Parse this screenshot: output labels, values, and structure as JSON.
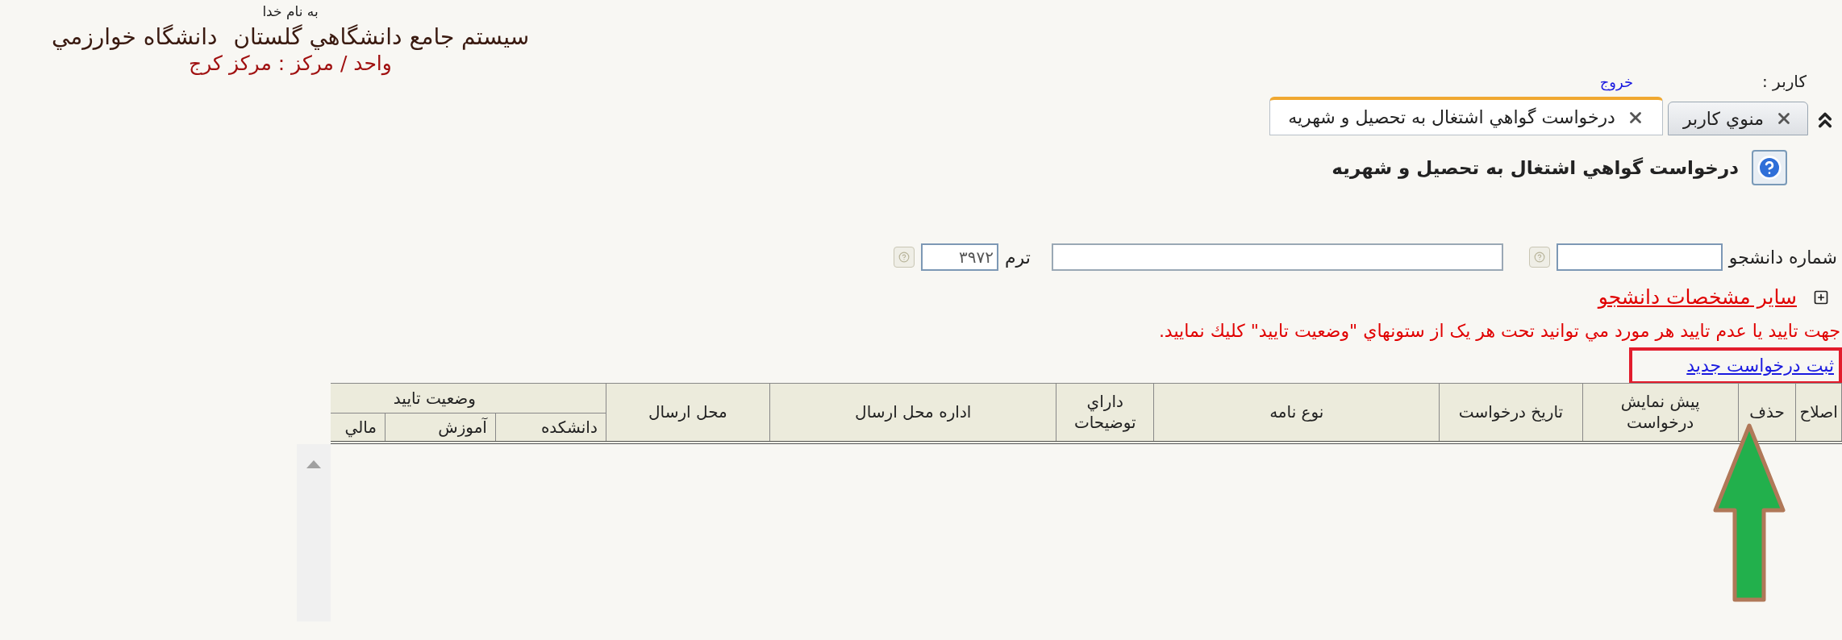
{
  "header": {
    "blessing": "به نام خدا",
    "system_title": "سيستم جامع دانشگاهي گلستان",
    "university": "دانشگاه خوارزمي",
    "unit": "واحد / مرکز : مرکز کرج"
  },
  "user": {
    "label": "کاربر :",
    "logout": "خروج"
  },
  "tabs": [
    {
      "label": "منوي کاربر",
      "selected": false
    },
    {
      "label": "درخواست گواهي اشتغال به تحصيل و شهريه",
      "selected": true
    }
  ],
  "page_title": "درخواست گواهي اشتغال به تحصيل و شهريه",
  "form": {
    "student_number_label": "شماره دانشجو",
    "term_label": "ترم",
    "term_value": "۳۹۷۲"
  },
  "other_details": {
    "label": "ساير مشخصات دانشجو",
    "expanded": false
  },
  "notice": "جهت تاييد يا عدم تاييد هر مورد مي توانيد تحت هر يک از ستونهاي \"وضعيت تاييد\" كليك نماييد.",
  "new_request_link": "ثبت درخواست جديد",
  "table": {
    "columns": [
      {
        "label": "اصلاح"
      },
      {
        "label": "حذف"
      },
      {
        "label": "پيش نمايش درخواست"
      },
      {
        "label": "تاريخ درخواست"
      },
      {
        "label": "نوع نامه"
      },
      {
        "label": "داراي توضيحات"
      },
      {
        "label": "اداره محل ارسال"
      },
      {
        "label": "محل ارسال"
      },
      {
        "label": "وضعيت تاييد",
        "children": [
          {
            "label": "دانشکده"
          },
          {
            "label": "آموزش"
          },
          {
            "label": "مالي"
          }
        ]
      }
    ]
  }
}
